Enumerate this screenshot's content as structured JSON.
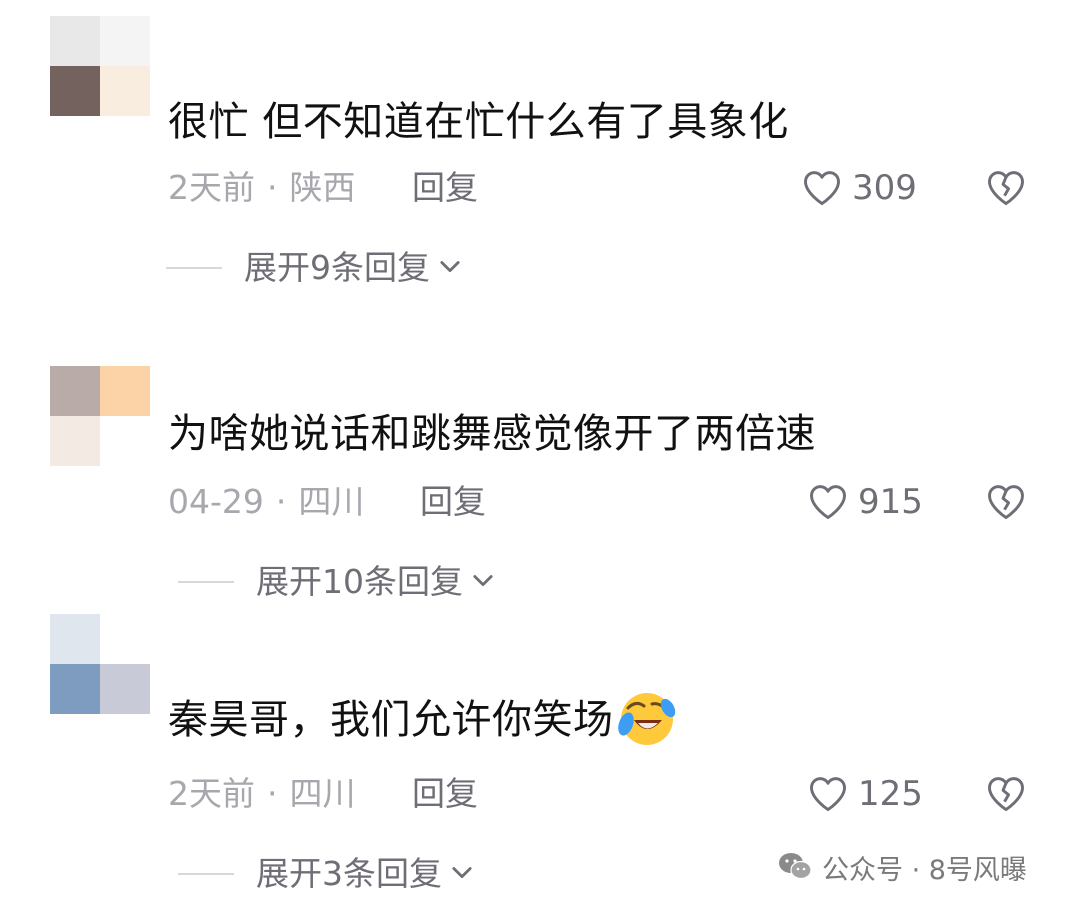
{
  "comments": [
    {
      "text": "很忙 但不知道在忙什么有了具象化",
      "time": "2天前",
      "location": "陕西",
      "reply_label": "回复",
      "likes": "309",
      "expand_label": "展开9条回复",
      "avatar_colors": [
        "#e8e8e8",
        "#f4f4f4",
        "#74625e",
        "#f8eddf"
      ]
    },
    {
      "text": "为啥她说话和跳舞感觉像开了两倍速",
      "time": "04-29",
      "location": "四川",
      "reply_label": "回复",
      "likes": "915",
      "expand_label": "展开10条回复",
      "avatar_colors": [
        "#b9aba8",
        "#fbd3a7",
        "#f3ebe3",
        "#ffffff"
      ]
    },
    {
      "text": "秦昊哥，我们允许你笑场",
      "emoji": "laughing-crying-emoji",
      "time": "2天前",
      "location": "四川",
      "reply_label": "回复",
      "likes": "125",
      "expand_label": "展开3条回复",
      "avatar_colors": [
        "#dfe6ee",
        "#ffffff",
        "#7e9cc0",
        "#c9cad8"
      ]
    }
  ],
  "separator": "·",
  "icons": {
    "like": "heart-outline-icon",
    "dislike": "broken-heart-icon",
    "expand": "chevron-down-icon",
    "watermark": "wechat-icon"
  },
  "watermark": {
    "text": "公众号 · 8号风曝"
  }
}
